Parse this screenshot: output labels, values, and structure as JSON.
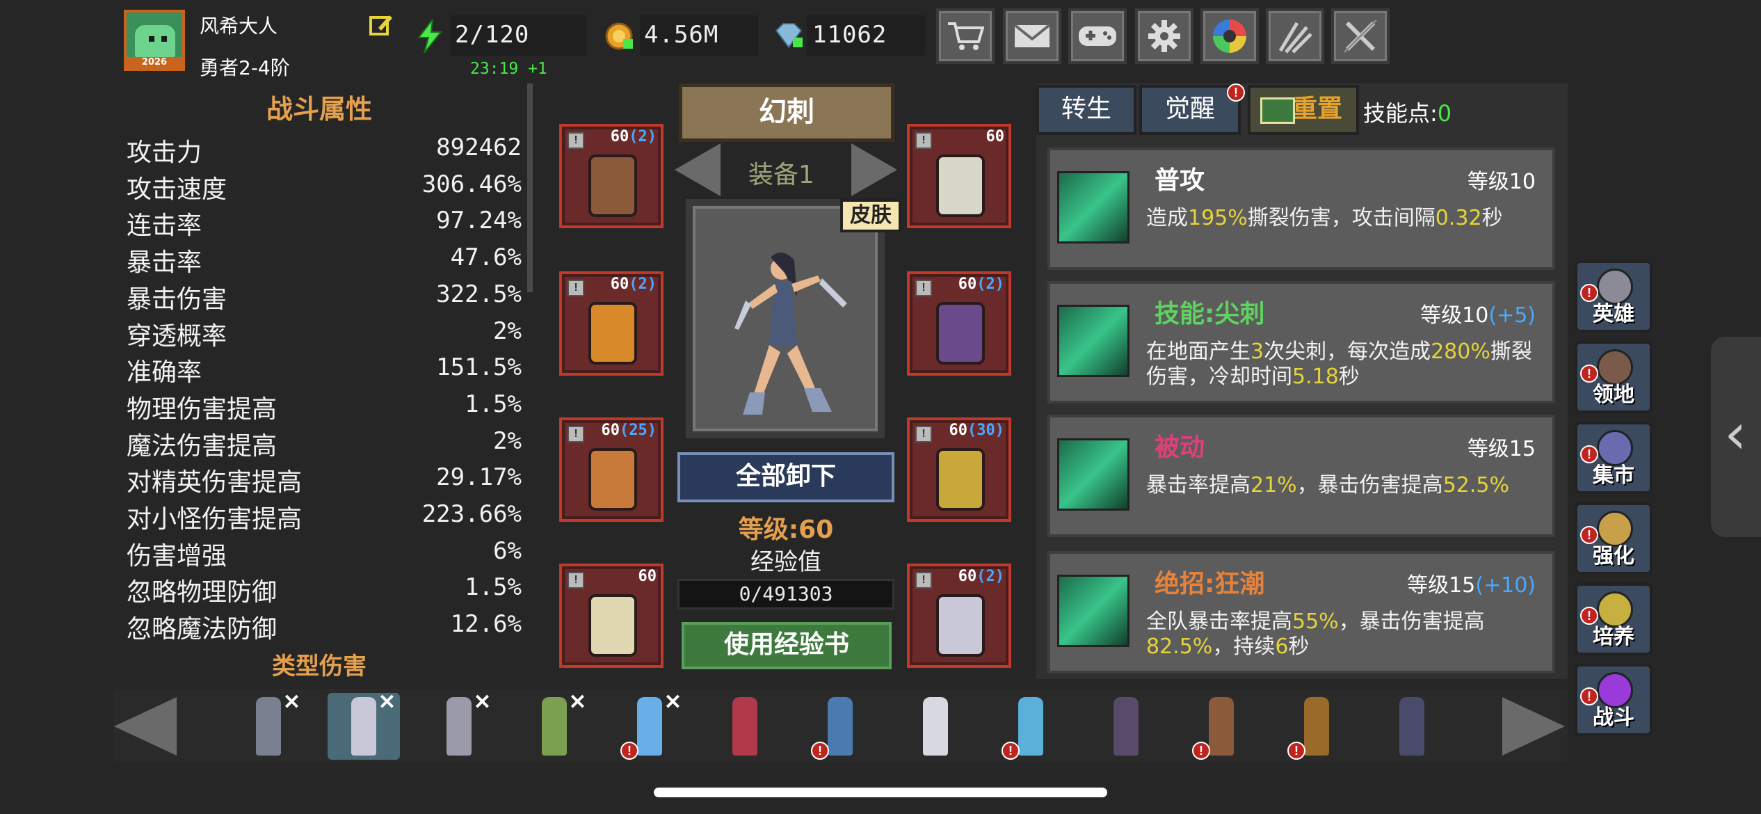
{
  "player": {
    "name": "风希大人",
    "rank": "勇者2-4阶",
    "avatar_year": "2026"
  },
  "resources": {
    "energy": "2/120",
    "energy_timer": "23:19 +1",
    "gold": "4.56M",
    "diamonds": "11062"
  },
  "toolbar_icons": [
    "cart-icon",
    "mail-icon",
    "gamepad-icon",
    "gear-icon",
    "shutter-icon",
    "burst-icon",
    "swords-disabled-icon"
  ],
  "stats": {
    "title": "战斗属性",
    "items": [
      {
        "name": "攻击力",
        "value": "892462"
      },
      {
        "name": "攻击速度",
        "value": "306.46%"
      },
      {
        "name": "连击率",
        "value": "97.24%"
      },
      {
        "name": "暴击率",
        "value": "47.6%"
      },
      {
        "name": "暴击伤害",
        "value": "322.5%"
      },
      {
        "name": "穿透概率",
        "value": "2%"
      },
      {
        "name": "准确率",
        "value": "151.5%"
      },
      {
        "name": "物理伤害提高",
        "value": "1.5%"
      },
      {
        "name": "魔法伤害提高",
        "value": "2%"
      },
      {
        "name": "对精英伤害提高",
        "value": "29.17%"
      },
      {
        "name": "对小怪伤害提高",
        "value": "223.66%"
      },
      {
        "name": "伤害增强",
        "value": "6%"
      },
      {
        "name": "忽略物理防御",
        "value": "1.5%"
      },
      {
        "name": "忽略魔法防御",
        "value": "12.6%"
      }
    ],
    "next_section": "类型伤害"
  },
  "hero": {
    "class_name": "幻刺",
    "equip_set": "装备1",
    "skin_label": "皮肤",
    "unequip_all": "全部卸下",
    "level_text": "等级:60",
    "exp_label": "经验值",
    "exp_text": "0/491303",
    "exp_fraction": 0,
    "use_exp_book": "使用经验书"
  },
  "equipment": [
    {
      "slot": "helmet",
      "lv": "60",
      "plus": "(2)"
    },
    {
      "slot": "amulet",
      "lv": "60",
      "plus": ""
    },
    {
      "slot": "armor",
      "lv": "60",
      "plus": "(2)"
    },
    {
      "slot": "gloves",
      "lv": "60",
      "plus": "(2)"
    },
    {
      "slot": "pants",
      "lv": "60",
      "plus": "(25)"
    },
    {
      "slot": "ring",
      "lv": "60",
      "plus": "(30)"
    },
    {
      "slot": "boots",
      "lv": "60",
      "plus": ""
    },
    {
      "slot": "weapon",
      "lv": "60",
      "plus": "(2)"
    }
  ],
  "tabs": {
    "rebirth": "转生",
    "awaken": "觉醒",
    "reset": "重置",
    "skill_points_label": "技能点:",
    "skill_points_value": "0"
  },
  "skills": [
    {
      "name": "普攻",
      "level": "等级10",
      "level_bonus": "",
      "name_color": "#ffffff",
      "desc": [
        [
          "造成",
          ""
        ],
        [
          "195%",
          "y"
        ],
        [
          "撕裂伤害，攻击间隔",
          ""
        ],
        [
          "0.32",
          "y"
        ],
        [
          "秒",
          ""
        ]
      ]
    },
    {
      "name": "技能:尖刺",
      "level": "等级10",
      "level_bonus": "(+5)",
      "name_color": "#5fd35f",
      "desc": [
        [
          "在地面产生",
          ""
        ],
        [
          "3",
          "y"
        ],
        [
          "次尖刺，每次造成",
          ""
        ],
        [
          "280%",
          "y"
        ],
        [
          "撕裂伤害，冷却时间",
          ""
        ],
        [
          "5.18",
          "y"
        ],
        [
          "秒",
          ""
        ]
      ]
    },
    {
      "name": "被动",
      "level": "等级15",
      "level_bonus": "",
      "name_color": "#e0407a",
      "desc": [
        [
          "暴击率提高",
          ""
        ],
        [
          "21%",
          "y"
        ],
        [
          "，暴击伤害提高",
          ""
        ],
        [
          "52.5%",
          "y"
        ]
      ]
    },
    {
      "name": "绝招:狂潮",
      "level": "等级15",
      "level_bonus": "(+10)",
      "name_color": "#e8823a",
      "desc": [
        [
          "全队暴击率提高",
          ""
        ],
        [
          "55%",
          "y"
        ],
        [
          "，暴击伤害提高 ",
          ""
        ],
        [
          "82.5%",
          "y"
        ],
        [
          "，持续",
          ""
        ],
        [
          "6",
          "y"
        ],
        [
          "秒",
          ""
        ]
      ]
    }
  ],
  "side_nav": [
    "英雄",
    "领地",
    "集市",
    "强化",
    "培养",
    "战斗"
  ],
  "heroes": [
    {
      "color": "#7a8090",
      "x": true,
      "alert": false
    },
    {
      "color": "#c8c8d8",
      "x": true,
      "alert": false,
      "selected": true
    },
    {
      "color": "#9a9aa8",
      "x": true,
      "alert": false
    },
    {
      "color": "#7aa050",
      "x": true,
      "alert": false
    },
    {
      "color": "#6aaee8",
      "x": true,
      "alert": true
    },
    {
      "color": "#b03a4a",
      "x": false,
      "alert": false
    },
    {
      "color": "#4a7ab0",
      "x": false,
      "alert": true
    },
    {
      "color": "#d8d8e0",
      "x": false,
      "alert": false
    },
    {
      "color": "#5ab0d8",
      "x": false,
      "alert": true
    },
    {
      "color": "#5a4a6a",
      "x": false,
      "alert": false
    },
    {
      "color": "#8a5a3a",
      "x": false,
      "alert": true
    },
    {
      "color": "#9a6a2a",
      "x": false,
      "alert": true
    },
    {
      "color": "#4a4a6a",
      "x": false,
      "alert": false
    }
  ]
}
